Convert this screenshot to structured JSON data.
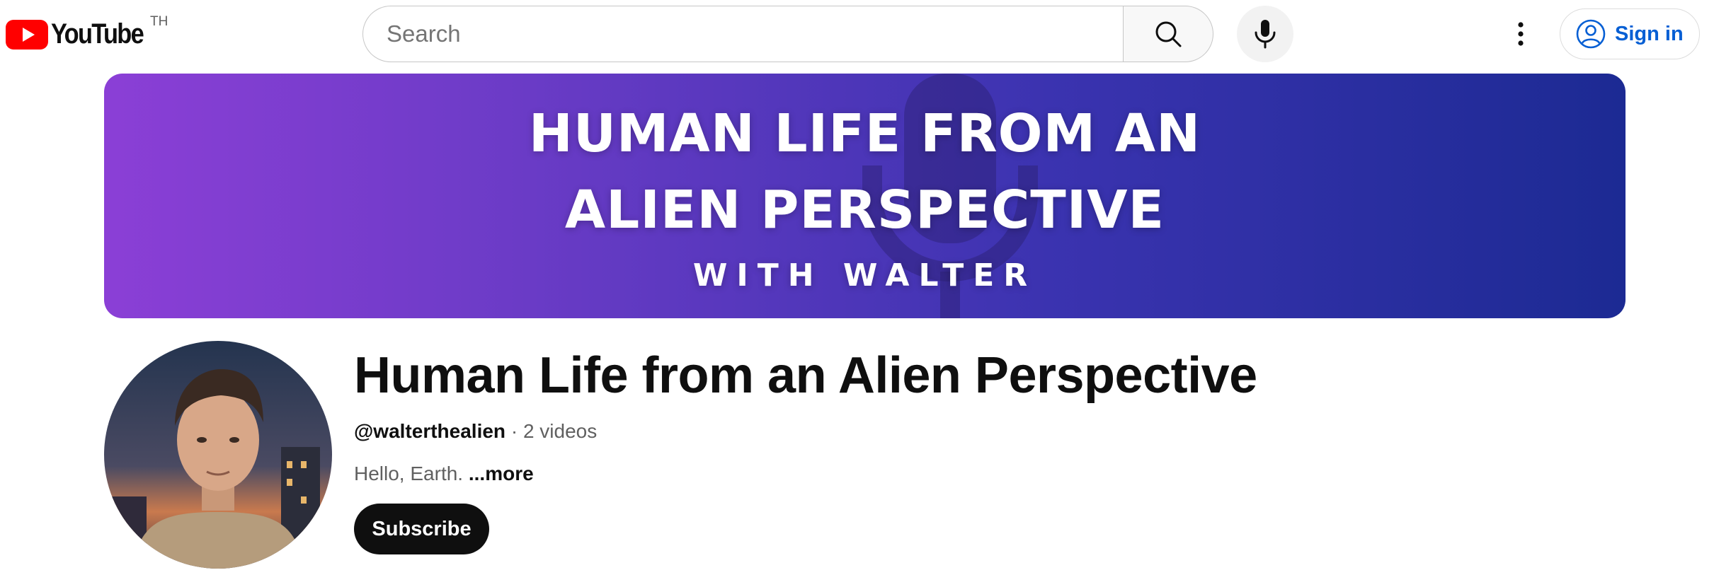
{
  "header": {
    "logo_text": "YouTube",
    "country_code": "TH",
    "search": {
      "placeholder": "Search"
    },
    "signin_label": "Sign in"
  },
  "banner": {
    "line1": "HUMAN LIFE FROM AN",
    "line2": "ALIEN PERSPECTIVE",
    "line3": "WITH WALTER"
  },
  "channel": {
    "title": "Human Life from an Alien Perspective",
    "handle": "@walterthealien",
    "separator": " · ",
    "video_count": "2 videos",
    "description": "Hello, Earth.",
    "more_label": "...more",
    "subscribe_label": "Subscribe"
  },
  "icons": {
    "logo": "youtube-play-icon",
    "search": "search-icon",
    "mic": "microphone-icon",
    "menu": "more-vert-icon",
    "account": "account-circle-icon"
  },
  "colors": {
    "brand_red": "#ff0000",
    "link_blue": "#065fd4",
    "banner_start": "#8b3fd6",
    "banner_end": "#1c2a93"
  }
}
